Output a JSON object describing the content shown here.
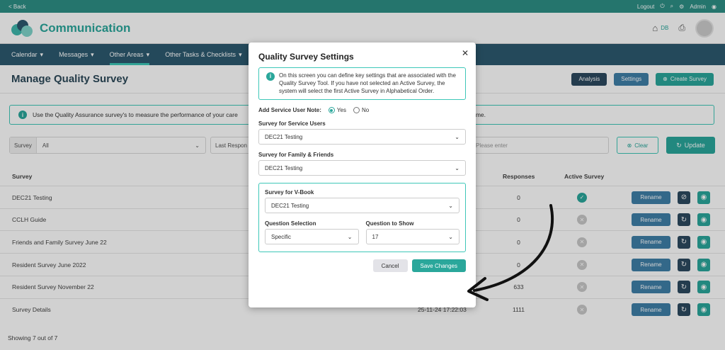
{
  "topbar": {
    "back": "< Back",
    "logout": "Logout",
    "admin": "Admin"
  },
  "header": {
    "brand": "Communication",
    "initials": "DB"
  },
  "nav": {
    "items": [
      {
        "label": "Calendar"
      },
      {
        "label": "Messages"
      },
      {
        "label": "Other Areas"
      },
      {
        "label": "Other Tasks & Checklists"
      }
    ]
  },
  "page": {
    "title": "Manage Quality Survey",
    "analysis": "Analysis",
    "settings": "Settings",
    "create": "Create Survey",
    "info_left": "Use the Quality Assurance survey's to measure the performance of your care",
    "info_right": "time.",
    "filter": {
      "survey_label": "Survey",
      "survey_value": "All",
      "last_resp": "Last Respon",
      "search_placeholder": "Please enter",
      "clear": "Clear",
      "update": "Update"
    }
  },
  "table": {
    "headers": {
      "survey": "Survey",
      "responses": "Responses",
      "active": "Active Survey"
    },
    "rename": "Rename",
    "rows": [
      {
        "name": "DEC21 Testing",
        "date": "",
        "responses": "0",
        "active": true
      },
      {
        "name": "CCLH Guide",
        "date": "",
        "responses": "0",
        "active": false
      },
      {
        "name": "Friends and Family Survey June 22",
        "date": "",
        "responses": "0",
        "active": false
      },
      {
        "name": "Resident Survey June 2022",
        "date": "",
        "responses": "0",
        "active": false
      },
      {
        "name": "Resident Survey November 22",
        "date": "",
        "responses": "633",
        "active": false
      },
      {
        "name": "Survey Details",
        "date": "25-11-24 17:22:03",
        "responses": "1111",
        "active": false
      }
    ],
    "footer": "Showing 7 out of 7"
  },
  "modal": {
    "title": "Quality Survey Settings",
    "info": "On this screen you can define key settings that are associated with the Quality Survey Tool. If you have not selected an Active Survey, the system will select the first Active Survey in Alphabetical Order.",
    "add_note_label": "Add Service User Note:",
    "yes": "Yes",
    "no": "No",
    "service_users_label": "Survey for Service Users",
    "service_users_value": "DEC21 Testing",
    "family_label": "Survey for Family & Friends",
    "family_value": "DEC21 Testing",
    "vbook_label": "Survey for V-Book",
    "vbook_value": "DEC21 Testing",
    "qsel_label": "Question Selection",
    "qsel_value": "Specific",
    "qshow_label": "Question to Show",
    "qshow_value": "17",
    "cancel": "Cancel",
    "save": "Save Changes"
  },
  "colors": {
    "teal": "#2aa79b",
    "navy": "#2d5a70"
  }
}
